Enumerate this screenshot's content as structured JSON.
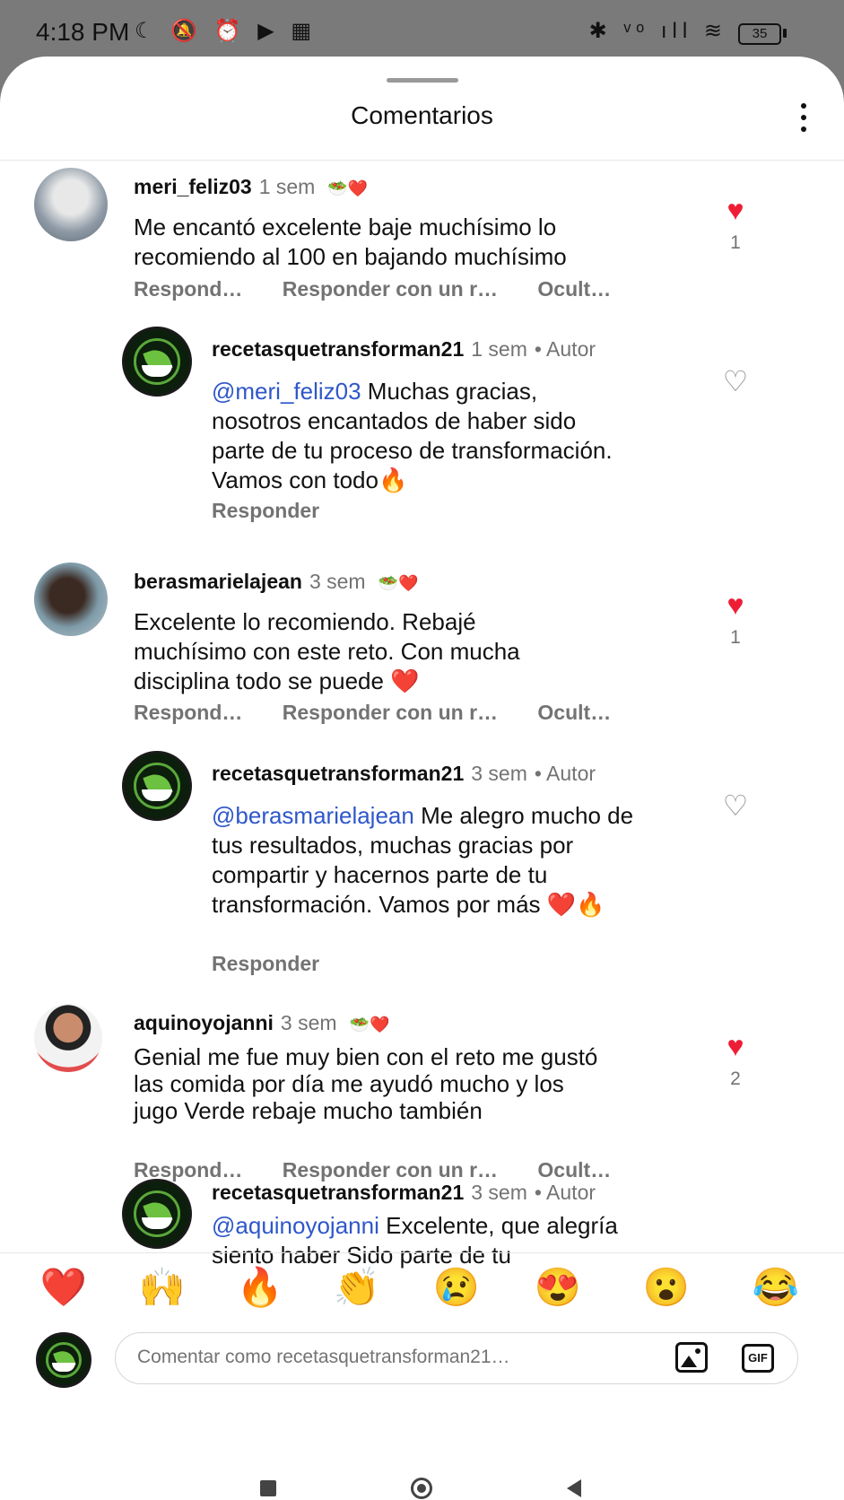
{
  "status_bar": {
    "time": "4:18 PM",
    "left_glyphs": "☾ 🔕 ⏰ ▶ ▦",
    "right_glyphs": "✱ ᵛᵒ ıll ≋",
    "battery": "35"
  },
  "header": {
    "title": "Comentarios"
  },
  "comments": [
    {
      "username": "meri_feliz03",
      "time": "1 sem",
      "badge": "🥗❤️",
      "text": "Me encantó excelente baje muchísimo lo recomiendo al 100 en bajando muchísimo",
      "actions": [
        "Respond…",
        "Responder con un r…",
        "Ocult…"
      ],
      "liked": true,
      "likes": "1",
      "reply": {
        "username": "recetasquetransforman21",
        "time": "1 sem",
        "author_label": "• Autor",
        "mention": "@meri_feliz03",
        "text": " Muchas gracias, nosotros encantados de haber sido parte de tu proceso de transformación. Vamos con todo🔥",
        "action": "Responder"
      }
    },
    {
      "username": "berasmarielajean",
      "time": "3 sem",
      "badge": "🥗❤️",
      "text": "Excelente lo recomiendo. Rebajé muchísimo con este reto. Con mucha disciplina todo se puede ❤️",
      "actions": [
        "Respond…",
        "Responder con un r…",
        "Ocult…"
      ],
      "liked": true,
      "likes": "1",
      "reply": {
        "username": "recetasquetransforman21",
        "time": "3 sem",
        "author_label": "• Autor",
        "mention": "@berasmarielajean",
        "text": " Me alegro mucho de tus resultados, muchas gracias por compartir y hacernos parte de tu transformación. Vamos por más ❤️🔥",
        "action": "Responder"
      }
    },
    {
      "username": "aquinoyojanni",
      "time": "3 sem",
      "badge": "🥗❤️",
      "text": "Genial me fue muy bien con  el reto me gustó las comida por día me ayudó mucho y los jugo Verde rebaje mucho también",
      "actions": [
        "Respond…",
        "Responder con un r…",
        "Ocult…"
      ],
      "liked": true,
      "likes": "2",
      "reply": {
        "username": "recetasquetransforman21",
        "time": "3 sem",
        "author_label": "• Autor",
        "mention": "@aquinoyojanni",
        "text": " Excelente, que alegría siento haber Sido parte de tu"
      }
    }
  ],
  "reactions": [
    "❤️",
    "🙌",
    "🔥",
    "👏",
    "😢",
    "😍",
    "😮",
    "😂"
  ],
  "composer": {
    "placeholder": "Comentar como recetasquetransforman21…",
    "gif_label": "GIF"
  },
  "icons": {
    "heart_filled": "♥",
    "heart_outline": "♡"
  },
  "colors": {
    "like_red": "#ee1d36",
    "mention_blue": "#2e57c9",
    "secondary_text": "#737373"
  }
}
